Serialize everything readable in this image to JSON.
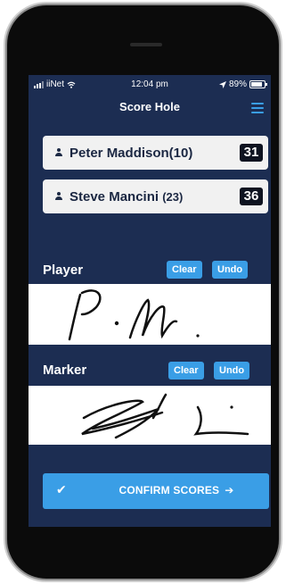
{
  "status": {
    "carrier": "iiNet",
    "time": "12:04 pm",
    "battery": "89%",
    "battery_fraction": 0.89
  },
  "nav": {
    "title": "Score Hole"
  },
  "players": [
    {
      "name": "Peter Maddison(10)",
      "score": "31"
    },
    {
      "name": "Steve Mancini",
      "handicap": "(23)",
      "score": "36"
    }
  ],
  "signatures": {
    "player": {
      "label": "Player",
      "clear": "Clear",
      "undo": "Undo"
    },
    "marker": {
      "label": "Marker",
      "clear": "Clear",
      "undo": "Undo"
    }
  },
  "confirm": {
    "label": "CONFIRM SCORES",
    "check": "✔",
    "arrow": "➔"
  },
  "colors": {
    "screen_bg": "#1c2d52",
    "accent": "#3a9ee6",
    "card_bg": "#f1f1f1",
    "score_bg": "#0e1320"
  }
}
